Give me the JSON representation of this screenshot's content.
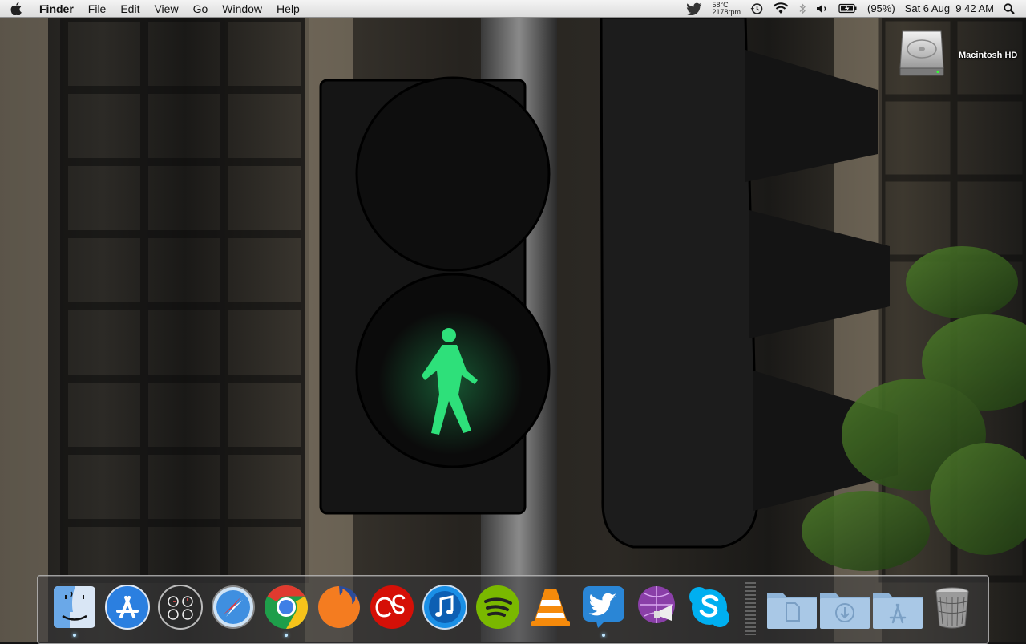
{
  "menubar": {
    "app_name": "Finder",
    "menus": [
      "File",
      "Edit",
      "View",
      "Go",
      "Window",
      "Help"
    ],
    "status": {
      "temperature": "58°C",
      "fan_speed": "2178rpm",
      "battery": "(95%)",
      "datetime": "Sat 6 Aug  9 42 AM"
    },
    "icons": [
      "apple-icon",
      "twitter-icon",
      "time-machine-icon",
      "wifi-icon",
      "bluetooth-icon",
      "volume-icon",
      "battery-icon",
      "spotlight-icon"
    ]
  },
  "desktop": {
    "drive_label": "Macintosh HD"
  },
  "dock": {
    "items": [
      {
        "name": "finder",
        "running": true
      },
      {
        "name": "app-store",
        "running": false
      },
      {
        "name": "dashboard",
        "running": false
      },
      {
        "name": "safari",
        "running": false
      },
      {
        "name": "chrome",
        "running": true
      },
      {
        "name": "firefox",
        "running": false
      },
      {
        "name": "lastfm",
        "running": false
      },
      {
        "name": "itunes",
        "running": false
      },
      {
        "name": "spotify",
        "running": false
      },
      {
        "name": "vlc",
        "running": false
      },
      {
        "name": "twitter",
        "running": true
      },
      {
        "name": "growl",
        "running": false
      },
      {
        "name": "skype",
        "running": false
      },
      {
        "name": "documents-folder",
        "running": false
      },
      {
        "name": "downloads-folder",
        "running": false
      },
      {
        "name": "applications-folder",
        "running": false
      },
      {
        "name": "trash",
        "running": false
      }
    ]
  },
  "colors": {
    "pedestrian_green": "#2ee07a",
    "menubar_bg": "#e8e8e8"
  }
}
